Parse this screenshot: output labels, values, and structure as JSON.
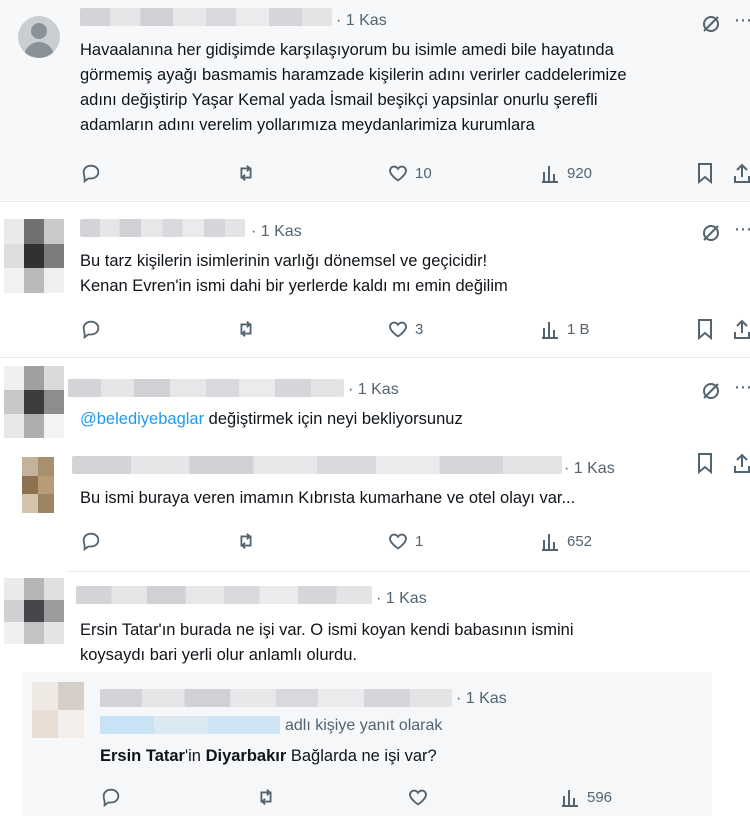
{
  "posts": [
    {
      "time": "· 1 Kas",
      "lines": [
        "Havaalanına her gidişimde karşılaşıyorum bu isimle amedi bile hayatında",
        "görmemiş ayağı basmamis haramzade kişilerin adını verirler caddelerimize",
        "adını değiştirip Yaşar Kemal yada İsmail beşikçi yapsinlar onurlu şerefli",
        "adamların adını verelim yollarımıza meydanlarimiza kurumlara"
      ],
      "likes": "10",
      "views": "920"
    },
    {
      "time": "· 1 Kas",
      "lines": [
        "Bu tarz kişilerin isimlerinin varlığı dönemsel ve geçicidir!",
        "Kenan Evren'in ismi dahi bir yerlerde kaldı mı emin değilim"
      ],
      "likes": "3",
      "views": "1 B"
    },
    {
      "time": "· 1 Kas",
      "mention": "@belediyebaglar",
      "rest": " değiştirmek için neyi bekliyorsunuz"
    },
    {
      "time": "· 1 Kas",
      "lines": [
        "Bu ismi buraya veren imamın Kıbrısta kumarhane ve otel olayı var..."
      ],
      "likes": "1",
      "views": "652"
    },
    {
      "time": "· 1 Kas",
      "lines": [
        "Ersin Tatar'ın burada ne işi var. O ismi koyan kendi babasının ismini",
        "koysaydı bari yerli olur anlamlı olurdu."
      ]
    }
  ],
  "quoted": {
    "time": "· 1 Kas",
    "reply_suffix": "adlı kişiye yanıt olarak",
    "name1": "Ersin Tatar",
    "mid": "'in ",
    "name2": "Diyarbakır",
    "tail": " Bağlarda ne işi var?",
    "views": "596"
  },
  "icons": {
    "reply": "reply-icon",
    "retweet": "retweet-icon",
    "like": "heart-icon",
    "views": "views-icon",
    "bookmark": "bookmark-icon",
    "share": "share-icon",
    "grok": "grok-icon",
    "more": "more-icon"
  },
  "colors": {
    "text": "#0f1419",
    "muted": "#536471",
    "link": "#1d9bf0"
  }
}
